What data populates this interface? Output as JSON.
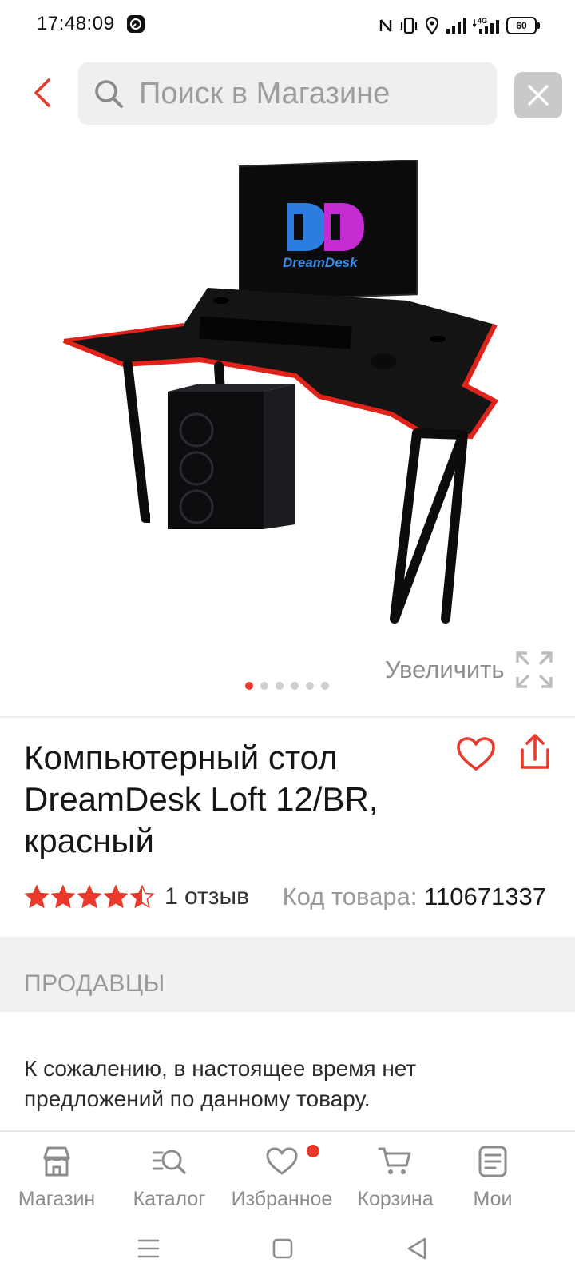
{
  "status_bar": {
    "time": "17:48:09",
    "battery": "60",
    "network": "4G"
  },
  "search": {
    "placeholder": "Поиск в Магазине",
    "value": ""
  },
  "product": {
    "title": "Компьютерный стол DreamDesk Loft 12/BR, красный",
    "image_logo_text": "DreamDesk",
    "zoom_label": "Увеличить",
    "carousel": {
      "total": 6,
      "active": 1
    },
    "rating": 4.5,
    "reviews_label": "1 отзыв",
    "sku_label": "Код товара: ",
    "sku_value": "110671337"
  },
  "sellers": {
    "title": "ПРОДАВЦЫ",
    "empty_message": "К сожалению, в настоящее время нет предложений по данному товару."
  },
  "bottom_nav": {
    "items": [
      {
        "label": "Магазин",
        "icon": "store-icon"
      },
      {
        "label": "Каталог",
        "icon": "catalog-search-icon"
      },
      {
        "label": "Избранное",
        "icon": "heart-icon",
        "badge": true
      },
      {
        "label": "Корзина",
        "icon": "cart-icon"
      },
      {
        "label": "Мои",
        "icon": "document-icon"
      }
    ]
  },
  "colors": {
    "accent": "#e8392b",
    "muted_text": "#999999",
    "search_bg": "#efefef"
  }
}
